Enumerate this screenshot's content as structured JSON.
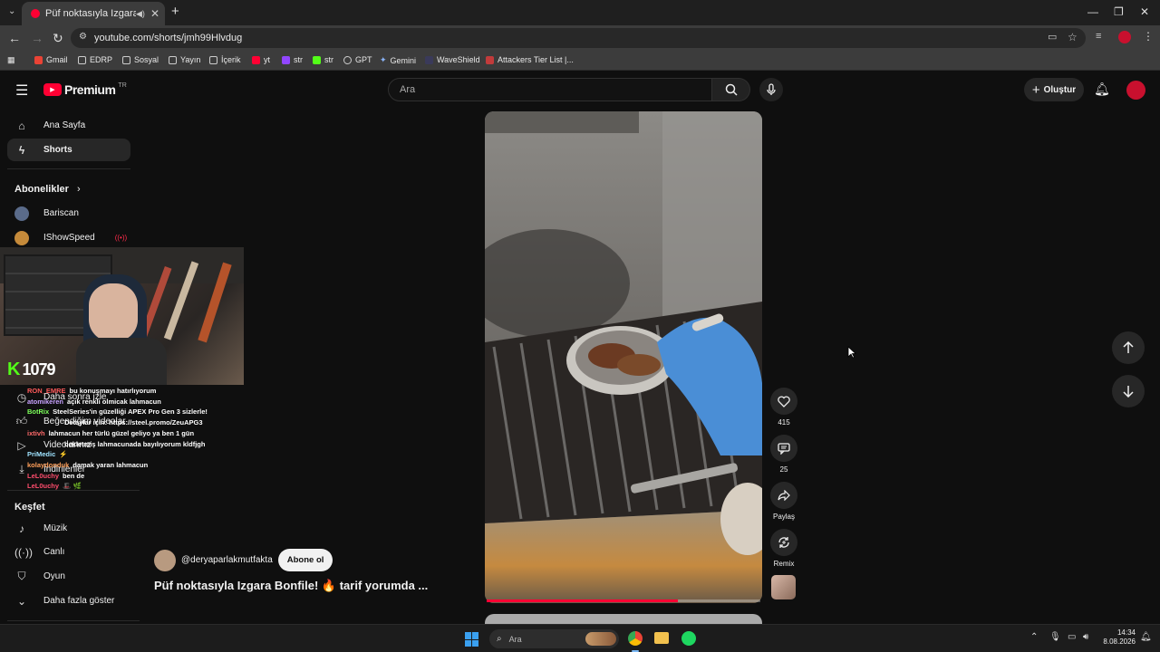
{
  "browser": {
    "tab_title": "Püf noktasıyla Izgara Bonfi...",
    "new_tab": "+",
    "url": "youtube.com/shorts/jmh99Hlvdug",
    "bookmarks": [
      "Gmail",
      "EDRP",
      "Sosyal",
      "Yayın",
      "İçerik",
      "yt",
      "str",
      "str",
      "GPT",
      "Gemini",
      "WaveShield",
      "Attackers Tier List |..."
    ]
  },
  "youtube": {
    "logo": "Premium",
    "region": "TR",
    "search_placeholder": "Ara",
    "create_label": "Oluştur"
  },
  "sidebar": {
    "home": "Ana Sayfa",
    "shorts": "Shorts",
    "subscriptions": "Abonelikler",
    "subs": [
      "Bariscan",
      "IShowSpeed"
    ],
    "watch_later": "Daha sonra izle",
    "liked": "Beğendiğim videolar",
    "your_videos": "Videolarınız",
    "downloads": "İndirilenler",
    "explore": "Keşfet",
    "explore_items": [
      "Müzik",
      "Canlı",
      "Oyun"
    ],
    "show_more": "Daha fazla göster"
  },
  "stream_overlay": {
    "viewer_count": "1079",
    "chat": [
      {
        "user": "RON_EMRE",
        "msg": "bu konuşmayı hatırlıyorum",
        "color": "#ff5a5a"
      },
      {
        "user": "atomikeren",
        "msg": "açık renkli olmicak lahmacun",
        "color": "#c8a2ff"
      },
      {
        "user": "BotRix",
        "msg": "SteelSeries'in güzelliği APEX Pro Gen 3 sizlerle!",
        "color": "#7cff5a"
      },
      {
        "user": "",
        "msg": "Detaylar için: https://steel.promo/ZeuAPG3",
        "color": "#ffffff"
      },
      {
        "user": "ixtivh",
        "msg": "lahmacun her türlü güzel geliyo ya ben 1 gün",
        "color": "#ff6a6a"
      },
      {
        "user": "",
        "msg": "bekletmiş lahmacunada bayılıyorum kldfjgh",
        "color": "#ffffff"
      },
      {
        "user": "PriMedic",
        "msg": "⚡",
        "color": "#9fe3ff"
      },
      {
        "user": "kolaydonduk",
        "msg": "damak yaran lahmacun",
        "color": "#ff9f5a"
      },
      {
        "user": "LeL0uchy",
        "msg": "ben de",
        "color": "#ff4d6d"
      },
      {
        "user": "LeL0uchy",
        "msg": "🎩 🌿",
        "color": "#ff4d6d"
      }
    ]
  },
  "short": {
    "channel": "@deryaparlakmutfakta",
    "subscribe": "Abone ol",
    "title": "Püf noktasıyla Izgara Bonfile! 🔥 tarif yorumda ...",
    "likes": "415",
    "comments": "25",
    "share": "Paylaş",
    "remix": "Remix",
    "progress": 0.7
  },
  "taskbar": {
    "search_placeholder": "Ara",
    "time": "14:34",
    "date": "8.08.2026"
  }
}
